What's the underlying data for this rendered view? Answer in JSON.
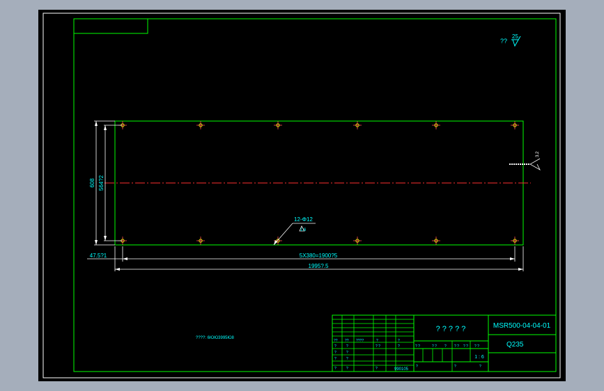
{
  "colors": {
    "background": "#000000",
    "frame": "#ffffff",
    "outline": "#00ff00",
    "dimension": "#ffffff",
    "text": "#00ffff",
    "centerline": "#ff3030",
    "hole_mark": "#ff5050",
    "hole_center": "#ffff00"
  },
  "roughness_note": {
    "prefix": "??",
    "value": "25"
  },
  "dimensions": {
    "overall_height": "608",
    "hole_span_vertical": "564?2",
    "left_offset": "47.5?1",
    "hole_pitch_total": "5X380=1900?5",
    "overall_length": "1995?.5",
    "right_roughness": "3.2"
  },
  "hole_callout": {
    "label": "12-Φ12",
    "sub": "1.6"
  },
  "note_text": "????: 6ЮЮ3995Ю8",
  "title_block": {
    "drawing_title": "? ? ? ? ?",
    "drawing_number": "MSR500-04-04-01",
    "material": "Q235",
    "scale": "1 : 6",
    "date": "990105",
    "header_cells": [
      "??",
      "??",
      "????",
      "?",
      "?"
    ],
    "mark_cells": [
      "?",
      "?",
      "?",
      "?",
      "?",
      "? ?",
      "?",
      "?",
      "?"
    ],
    "row_marks": [
      "?",
      "?",
      "?",
      "?",
      "?"
    ],
    "scale_header": [
      "? ?",
      "? ?",
      "?",
      "? ?",
      "? ?",
      "? ?"
    ],
    "bottom_marks": [
      "?",
      "?",
      "?"
    ]
  }
}
